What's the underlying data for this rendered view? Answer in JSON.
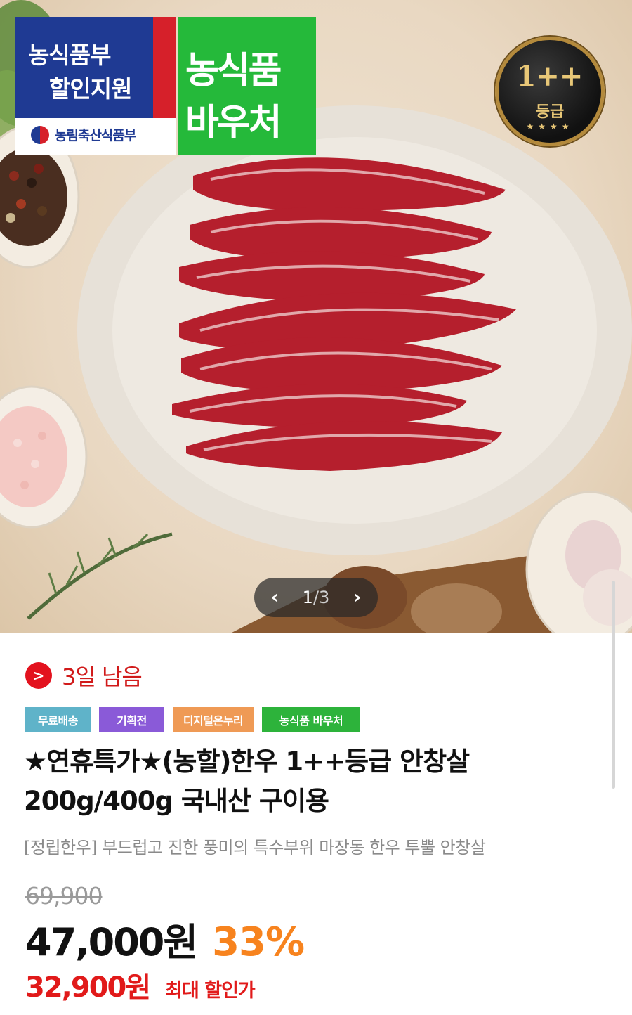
{
  "hero": {
    "gov_badge": {
      "line1": "농식품부",
      "line2": "할인지원",
      "ministry": "농림축산식품부"
    },
    "voucher_badge": {
      "line1": "농식품",
      "line2": "바우처"
    },
    "grade_badge": {
      "grade": "1++",
      "label": "등급"
    },
    "pager": {
      "current": "1",
      "separator": "/",
      "total": "3",
      "prev_icon": "chevron-left-icon",
      "next_icon": "chevron-right-icon"
    }
  },
  "deadline": {
    "icon": "arrow-right-icon",
    "text": "3일 남음"
  },
  "tags": [
    {
      "label": "무료배송",
      "color": "#5fb3c9"
    },
    {
      "label": "기획전",
      "color": "#8a5ad8"
    },
    {
      "label": "디지털온누리",
      "color": "#ef9a55"
    },
    {
      "label": "농식품 바우처",
      "color": "#2db33b"
    }
  ],
  "product": {
    "title": "★연휴특가★(농할)한우 1++등급 안창살 200g/400g 국내산 구이용",
    "subtitle": "[정립한우] 부드럽고 진한 풍미의 특수부위 마장동 한우 투뿔 안창살"
  },
  "price": {
    "original": "69,900",
    "sale": "47,000원",
    "discount": "33%",
    "max_discount_price": "32,900원",
    "max_discount_label": "최대 할인가"
  },
  "colors": {
    "accent_red": "#e11a1a",
    "discount_orange": "#f7831e",
    "voucher_green": "#25b93a",
    "gov_blue": "#1f3a93"
  }
}
